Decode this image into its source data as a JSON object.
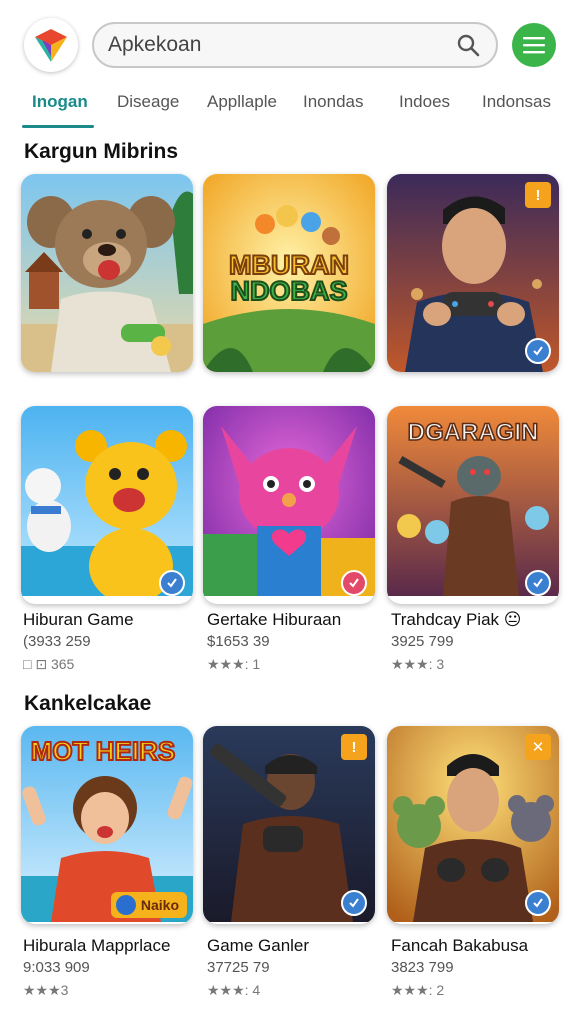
{
  "header": {
    "search_value": "Apkekoan",
    "logo_icon": "colorful-cube-logo",
    "menu_icon": "hamburger-menu-icon",
    "accent_color": "#3bb54a"
  },
  "tabs": [
    {
      "label": "Inogan",
      "active": true
    },
    {
      "label": "Diseage"
    },
    {
      "label": "Appllaple"
    },
    {
      "label": "Inondas"
    },
    {
      "label": "Indoes"
    },
    {
      "label": "Indonsas"
    }
  ],
  "sections": [
    {
      "title": "Kargun Mibrins",
      "apps": [
        {
          "art": "bear-on-beach"
        },
        {
          "art": "mburan-ndobas",
          "art_text1": "MBURAN",
          "art_text2": "NDOBAS"
        },
        {
          "art": "man-with-gamepad",
          "badge": "!"
        }
      ]
    },
    {
      "title": "",
      "apps": [
        {
          "art": "yellow-bear",
          "name": "Hiburan Game",
          "sub": "(3933 259",
          "rating": "□ ⊡ 365"
        },
        {
          "art": "pink-creature",
          "name": "Gertake Hiburaan",
          "sub": "$1653 39",
          "rating": "★★★: 1"
        },
        {
          "art": "dgaragin-warrior",
          "art_text": "DGARAGIN",
          "name": "Trahdcay Piak 😐",
          "sub": "3925 799",
          "rating": "★★★: 3"
        }
      ]
    },
    {
      "title": "Kankelcakae",
      "apps": [
        {
          "art": "mot-heirs-girl",
          "art_text": "MOT HEIRS",
          "tag": "Naiko",
          "name": "Hiburala Mapprlace",
          "sub": "9:033 909",
          "rating": "★★★3"
        },
        {
          "art": "man-with-gun",
          "badge": "!",
          "name": "Game Ganler",
          "sub": "37725 79",
          "rating": "★★★: 4"
        },
        {
          "art": "man-with-mice",
          "badge": "✕",
          "name": "Fancah Bakabusa",
          "sub": "3823 799",
          "rating": "★★★: 2"
        }
      ]
    }
  ]
}
